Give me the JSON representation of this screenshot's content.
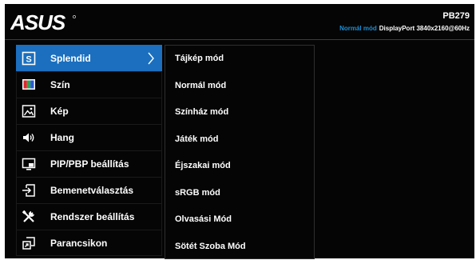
{
  "header": {
    "brand": "ASUS",
    "model": "PB279",
    "status": {
      "mode": "Normál mód",
      "input": "DisplayPort",
      "resolution": "3840x2160@60Hz"
    }
  },
  "colors": {
    "background": "#050505",
    "accent": "#1b6fbe",
    "status_mode": "#1c8fd6",
    "text": "#ffffff"
  },
  "menu": {
    "items": [
      {
        "label": "Splendid",
        "icon": "splendid-icon",
        "selected": true
      },
      {
        "label": "Szín",
        "icon": "color-icon"
      },
      {
        "label": "Kép",
        "icon": "image-icon"
      },
      {
        "label": "Hang",
        "icon": "speaker-icon"
      },
      {
        "label": "PIP/PBP beállítás",
        "icon": "pip-icon"
      },
      {
        "label": "Bemenetválasztás",
        "icon": "input-select-icon"
      },
      {
        "label": "Rendszer beállítás",
        "icon": "tools-icon"
      },
      {
        "label": "Parancsikon",
        "icon": "shortcut-icon"
      }
    ]
  },
  "submenu": {
    "items": [
      {
        "label": "Tájkép mód"
      },
      {
        "label": "Normál mód"
      },
      {
        "label": "Színház mód"
      },
      {
        "label": "Játék mód"
      },
      {
        "label": "Éjszakai mód"
      },
      {
        "label": "sRGB mód"
      },
      {
        "label": "Olvasási Mód"
      },
      {
        "label": "Sötét Szoba Mód"
      }
    ]
  }
}
